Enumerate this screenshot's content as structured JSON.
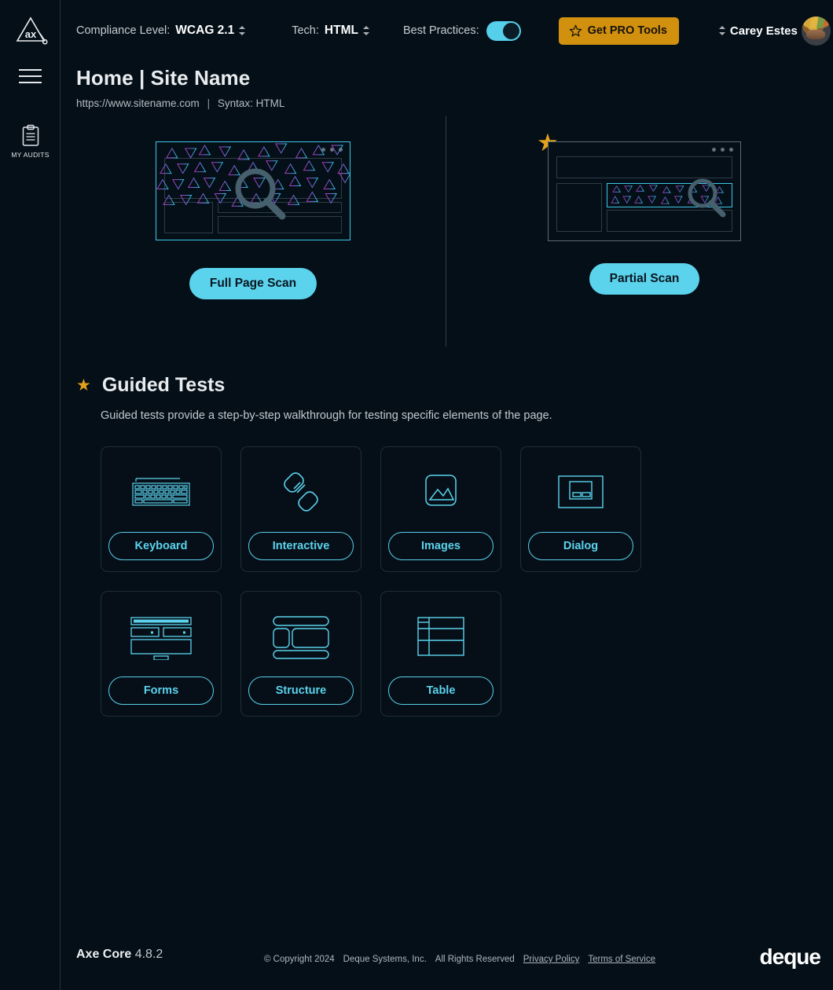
{
  "app": {
    "logo_alt": "axe",
    "brand": "deque"
  },
  "sidebar": {
    "menu_icon": "hamburger-icon",
    "items": [
      {
        "label": "MY AUDITS",
        "icon": "clipboard-icon"
      }
    ]
  },
  "topbar": {
    "compliance_label": "Compliance Level:",
    "compliance_value": "WCAG 2.1",
    "tech_label": "Tech:",
    "tech_value": "HTML",
    "best_practices_label": "Best Practices:",
    "best_practices_on": true,
    "pro_button": "Get PRO Tools",
    "pro_icon": "star-outline-icon",
    "user_name": "Carey Estes"
  },
  "header": {
    "title": "Home  |  Site Name",
    "url": "https://www.sitename.com",
    "separator": "|",
    "syntax": "Syntax: HTML"
  },
  "scans": [
    {
      "id": "full-page-scan",
      "label": "Full Page Scan",
      "pro": false
    },
    {
      "id": "partial-scan",
      "label": "Partial Scan",
      "pro": true
    }
  ],
  "guided_tests": {
    "title": "Guided Tests",
    "description": "Guided tests provide a step-by-step walkthrough for testing specific elements of the page.",
    "star_icon": "star-filled-icon",
    "cards": [
      {
        "label": "Keyboard",
        "icon": "keyboard-icon"
      },
      {
        "label": "Interactive",
        "icon": "link-chain-icon"
      },
      {
        "label": "Images",
        "icon": "image-icon"
      },
      {
        "label": "Dialog",
        "icon": "dialog-icon"
      },
      {
        "label": "Forms",
        "icon": "form-icon"
      },
      {
        "label": "Structure",
        "icon": "layout-icon"
      },
      {
        "label": "Table",
        "icon": "table-icon"
      }
    ]
  },
  "footer": {
    "engine_name": "Axe Core",
    "engine_version": "4.8.2",
    "copyright": "© Copyright 2024",
    "company": "Deque Systems, Inc.",
    "rights": "All Rights Reserved",
    "privacy_link": "Privacy Policy",
    "terms_link": "Terms of Service",
    "brand": "deque"
  },
  "colors": {
    "background": "#050f17",
    "accent_cyan": "#5bd3ec",
    "accent_amber": "#d1910f",
    "star_gold": "#e3a21c",
    "text_primary": "#e8ecef",
    "text_secondary": "#b4bbc1"
  }
}
